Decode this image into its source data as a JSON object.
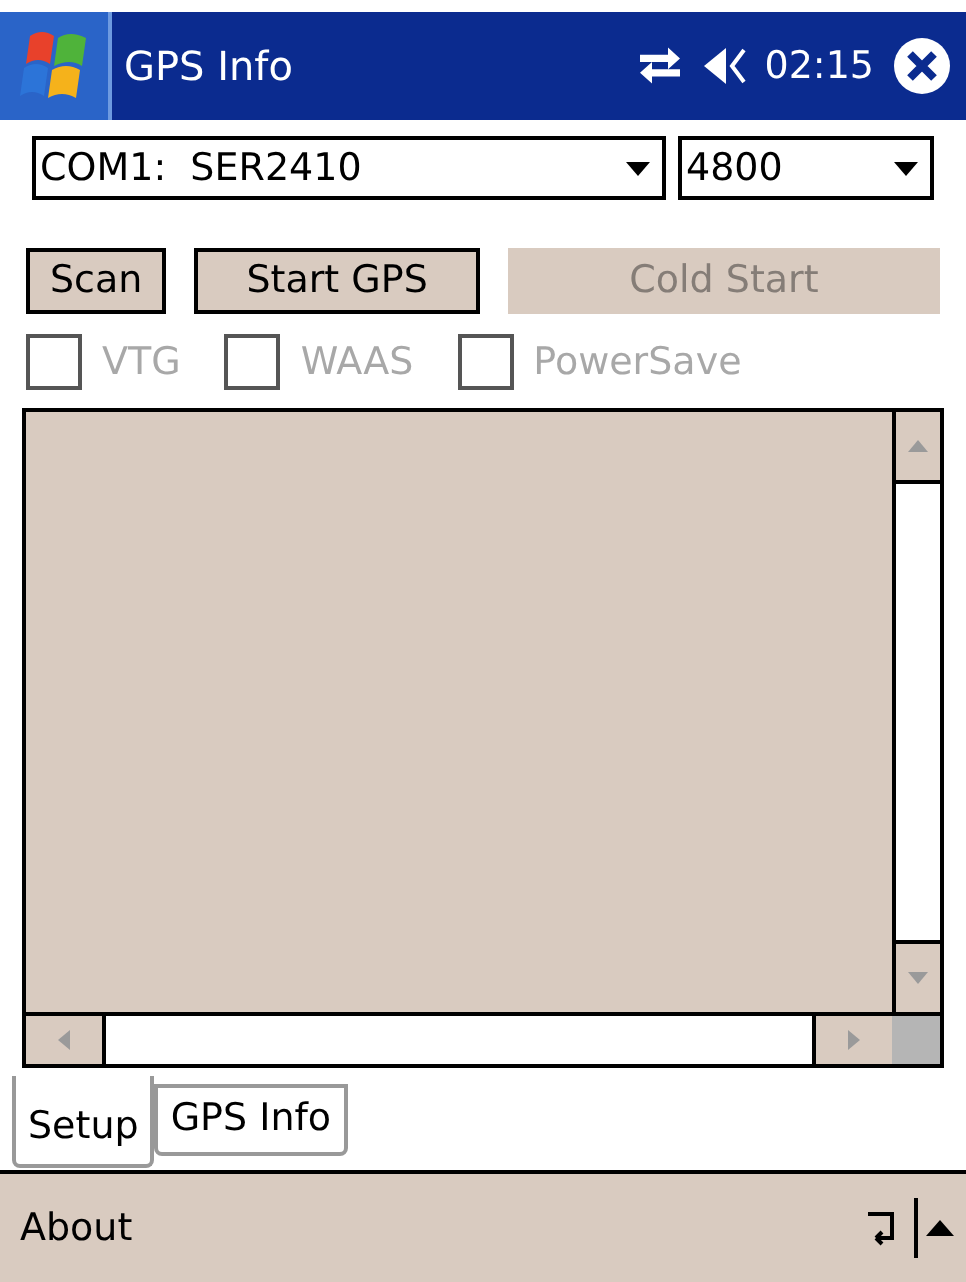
{
  "title_bar": {
    "title": "GPS Info",
    "time": "02:15"
  },
  "port_select": {
    "value": "COM1:  SER2410"
  },
  "baud_select": {
    "value": "4800"
  },
  "buttons": [
    {
      "label": "Scan",
      "disabled": false
    },
    {
      "label": "Start GPS",
      "disabled": false
    },
    {
      "label": "Cold Start",
      "disabled": true
    }
  ],
  "options": [
    {
      "label": "VTG",
      "checked": false,
      "disabled": true
    },
    {
      "label": "WAAS",
      "checked": false,
      "disabled": true
    },
    {
      "label": "PowerSave",
      "checked": false,
      "disabled": true
    }
  ],
  "tabs": [
    {
      "label": "Setup",
      "selected": true
    },
    {
      "label": "GPS Info",
      "selected": false
    }
  ],
  "menu_bar": {
    "items": [
      "About"
    ]
  }
}
